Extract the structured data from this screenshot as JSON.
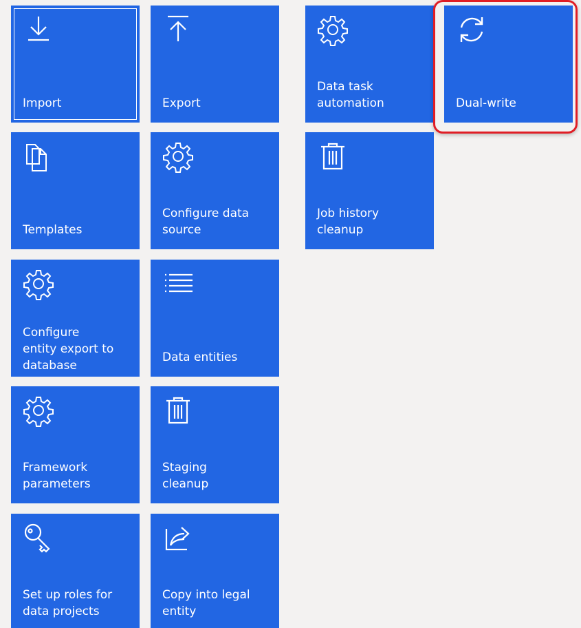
{
  "colors": {
    "tile_background": "#2266e3",
    "page_background": "#f3f2f1",
    "highlight": "#e01e26"
  },
  "tiles": [
    {
      "label": "Import",
      "icon": "download-icon"
    },
    {
      "label": "Export",
      "icon": "upload-icon"
    },
    {
      "label": "Data task\nautomation",
      "icon": "gear-icon"
    },
    {
      "label": "Dual-write",
      "icon": "sync-icon"
    },
    {
      "label": "Templates",
      "icon": "copy-icon"
    },
    {
      "label": "Configure data\nsource",
      "icon": "gear-icon"
    },
    {
      "label": "Job history\ncleanup",
      "icon": "trash-icon"
    },
    {
      "label": "Configure\nentity export to\ndatabase",
      "icon": "gear-icon"
    },
    {
      "label": "Data entities",
      "icon": "list-icon"
    },
    {
      "label": "Framework\nparameters",
      "icon": "gear-icon"
    },
    {
      "label": "Staging\ncleanup",
      "icon": "trash-icon"
    },
    {
      "label": "Set up roles for\ndata projects",
      "icon": "key-icon"
    },
    {
      "label": "Copy into legal\nentity",
      "icon": "share-icon"
    }
  ]
}
